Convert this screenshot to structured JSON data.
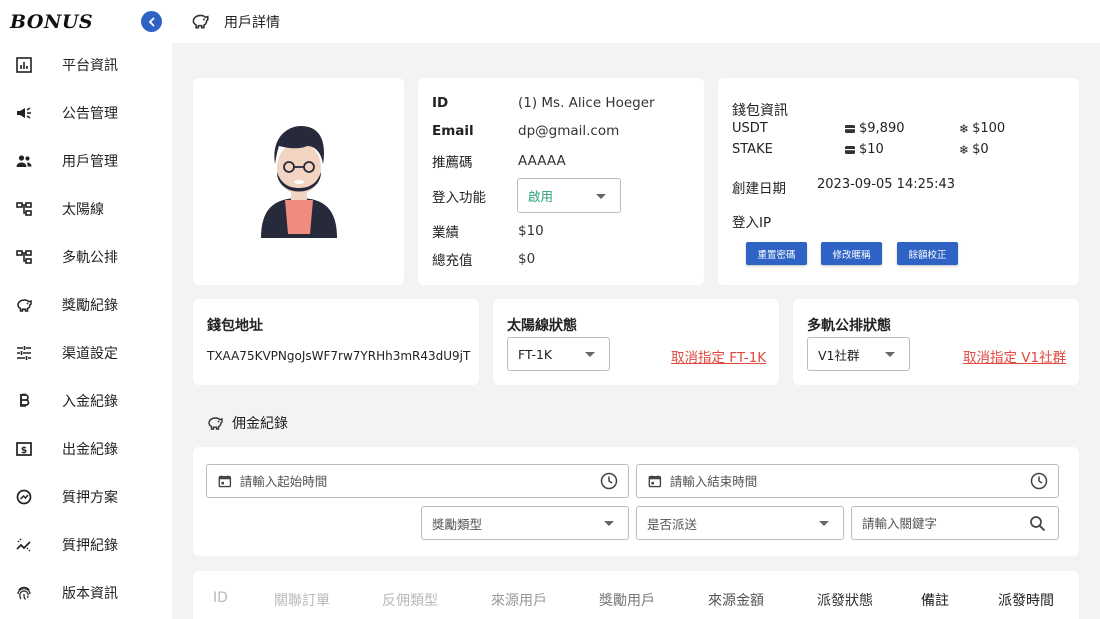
{
  "brand": {
    "logo_text": "BONUS",
    "accent": "#2e63c5"
  },
  "header": {
    "title": "用戶詳情",
    "icon": "piggy-bank-icon"
  },
  "sidebar": {
    "items": [
      {
        "label": "平台資訊",
        "icon": "bar-chart-icon"
      },
      {
        "label": "公告管理",
        "icon": "megaphone-icon"
      },
      {
        "label": "用戶管理",
        "icon": "users-icon"
      },
      {
        "label": "太陽線",
        "icon": "hierarchy-icon"
      },
      {
        "label": "多軌公排",
        "icon": "hierarchy-icon"
      },
      {
        "label": "獎勵紀錄",
        "icon": "piggy-bank-icon"
      },
      {
        "label": "渠道設定",
        "icon": "sliders-icon"
      },
      {
        "label": "入金紀錄",
        "icon": "bitcoin-icon"
      },
      {
        "label": "出金紀錄",
        "icon": "dollar-box-icon"
      },
      {
        "label": "質押方案",
        "icon": "gauge-icon"
      },
      {
        "label": "質押紀錄",
        "icon": "trend-icon"
      },
      {
        "label": "版本資訊",
        "icon": "fingerprint-icon"
      }
    ]
  },
  "profile": {
    "id_label": "ID",
    "id_value": "(1)  Ms. Alice Hoeger",
    "email_label": "Email",
    "email_value": "dp@gmail.com",
    "referral_label": "推薦碼",
    "referral_value": "AAAAA",
    "login_label": "登入功能",
    "login_value": "啟用",
    "performance_label": "業績",
    "performance_value": "$10",
    "recharge_label": "總充值",
    "recharge_value": "$0"
  },
  "wallet": {
    "title": "錢包資訊",
    "rows": [
      {
        "currency": "USDT",
        "wallet": "$9,890",
        "frozen": "$100"
      },
      {
        "currency": "STAKE",
        "wallet": "$10",
        "frozen": "$0"
      }
    ],
    "created_label": "創建日期",
    "created_value": "2023-09-05 14:25:43",
    "ip_label": "登入IP",
    "buttons": [
      "重置密碼",
      "修改暱稱",
      "餘額校正"
    ]
  },
  "address": {
    "title": "錢包地址",
    "value": "TXAA75KVPNgoJsWF7rw7YRHh3mR43dU9jT"
  },
  "sunline": {
    "title": "太陽線狀態",
    "select": "FT-1K",
    "link": "取消指定 FT-1K"
  },
  "multitrack": {
    "title": "多軌公排狀態",
    "select": "V1社群",
    "link": "取消指定 V1社群"
  },
  "commission": {
    "title": "佣金紀錄",
    "start_placeholder": "請輸入起始時間",
    "end_placeholder": "請輸入結束時間",
    "reward_type": "獎勵類型",
    "dispatched": "是否派送",
    "keyword_placeholder": "請輸入關鍵字"
  },
  "table": {
    "headers": [
      "ID",
      "關聯訂單",
      "反佣類型",
      "來源用戶",
      "獎勵用戶",
      "來源金額",
      "派發狀態",
      "備註",
      "派發時間"
    ]
  },
  "colors": {
    "primary": "#2e63c5",
    "danger": "#e0493f",
    "success": "#26a07a"
  }
}
